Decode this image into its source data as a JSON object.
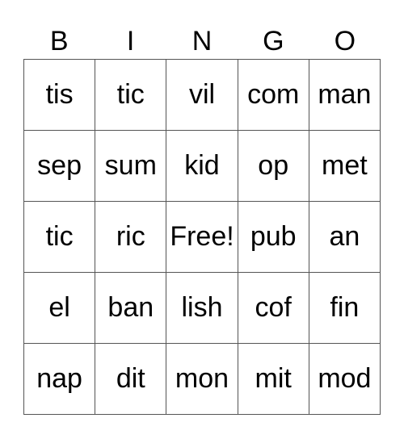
{
  "header": [
    "B",
    "I",
    "N",
    "G",
    "O"
  ],
  "rows": [
    [
      "tis",
      "tic",
      "vil",
      "com",
      "man"
    ],
    [
      "sep",
      "sum",
      "kid",
      "op",
      "met"
    ],
    [
      "tic",
      "ric",
      "Free!",
      "pub",
      "an"
    ],
    [
      "el",
      "ban",
      "lish",
      "cof",
      "fin"
    ],
    [
      "nap",
      "dit",
      "mon",
      "mit",
      "mod"
    ]
  ]
}
